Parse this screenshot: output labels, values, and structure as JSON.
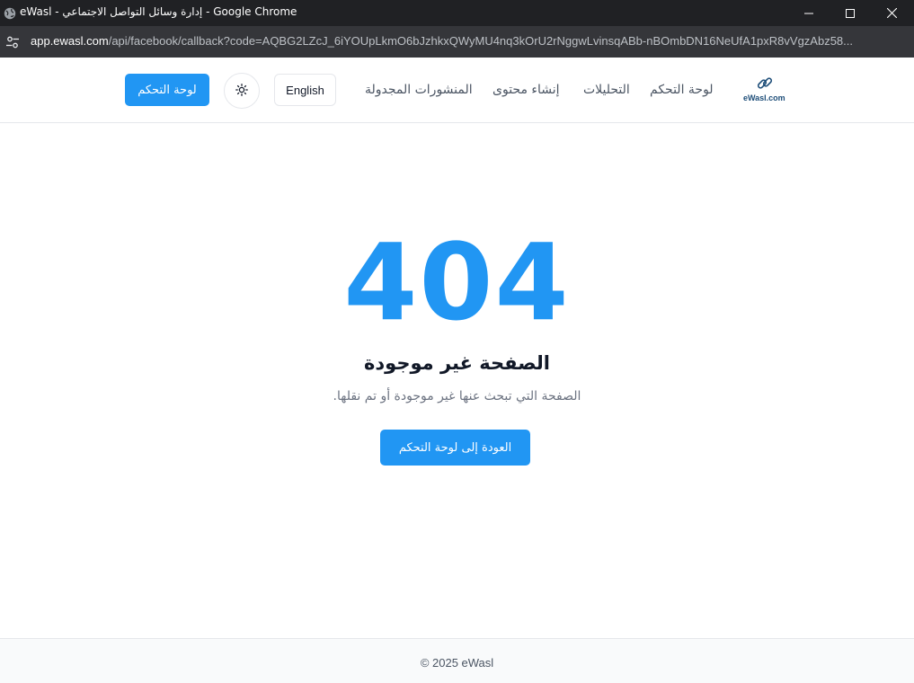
{
  "window": {
    "title": "eWasl - إدارة وسائل التواصل الاجتماعي - Google Chrome",
    "icon": "globe-icon",
    "controls": [
      "minimize-icon",
      "maximize-icon",
      "close-icon"
    ]
  },
  "addressbar": {
    "host": "app.ewasl.com",
    "path": "/api/facebook/callback?code=AQBG2LZcJ_6iYOUpLkmO6bJzhkxQWyMU4nq3kOrU2rNggwLvinsqABb-nBOmbDN16NeUfA1pxR8vVgzAbz58..."
  },
  "header": {
    "logo_text": "eWasl.com",
    "nav": {
      "dashboard": "لوحة التحكم",
      "analytics": "التحليلات",
      "create_content": "إنشاء محتوى",
      "scheduled_posts": "المنشورات المجدولة"
    },
    "language_label": "English",
    "theme_icon": "sun-icon",
    "dashboard_button": "لوحة التحكم"
  },
  "main": {
    "code": "404",
    "title": "الصفحة غير موجودة",
    "description": "الصفحة التي تبحث عنها غير موجودة أو تم نقلها.",
    "back_button": "العودة إلى لوحة التحكم"
  },
  "footer": {
    "copyright": "© 2025 eWasl"
  },
  "colors": {
    "accent": "#2196f3",
    "titlebar": "#202124",
    "addressbar": "#35363a"
  }
}
